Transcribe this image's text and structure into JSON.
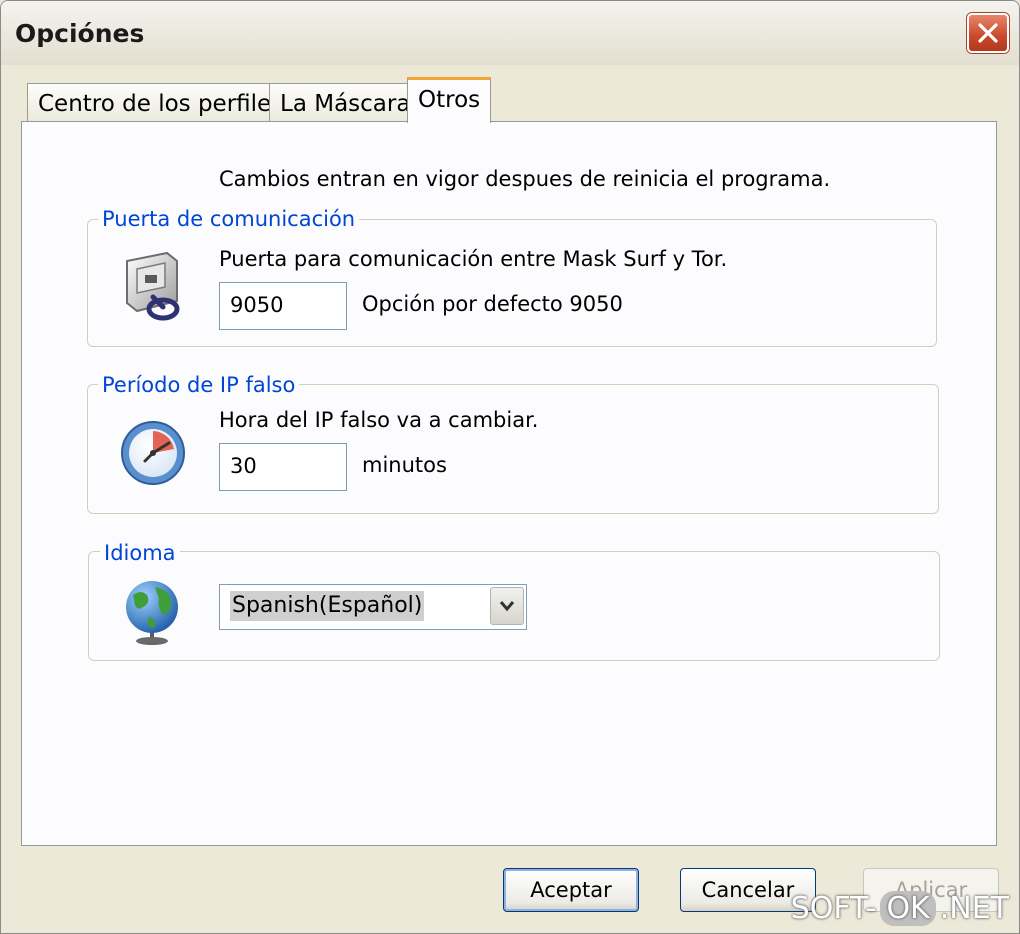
{
  "window": {
    "title": "Opciónes"
  },
  "tabs": [
    {
      "label": "Centro de los perfiles"
    },
    {
      "label": "La Máscara"
    },
    {
      "label": "Otros",
      "active": true
    }
  ],
  "panel": {
    "notice": "Cambios entran en vigor despues de reinicia el programa."
  },
  "port_group": {
    "legend": "Puerta de comunicación",
    "description": "Puerta para comunicación entre Mask Surf y Tor.",
    "value": "9050",
    "hint": "Opción por defecto 9050"
  },
  "ip_group": {
    "legend": "Período de IP falso",
    "description": "Hora del IP falso va a cambiar.",
    "value": "30",
    "unit": "minutos"
  },
  "language_group": {
    "legend": "Idioma",
    "selected": "Spanish(Español)"
  },
  "buttons": {
    "accept": "Aceptar",
    "cancel": "Cancelar",
    "apply": "Aplicar"
  },
  "watermark": {
    "left": "SOFT-",
    "mid": "OK",
    "right": ".NET"
  },
  "colors": {
    "legend": "#0046d5",
    "close_button": "#c9482b",
    "active_tab_accent": "#f3a534"
  }
}
